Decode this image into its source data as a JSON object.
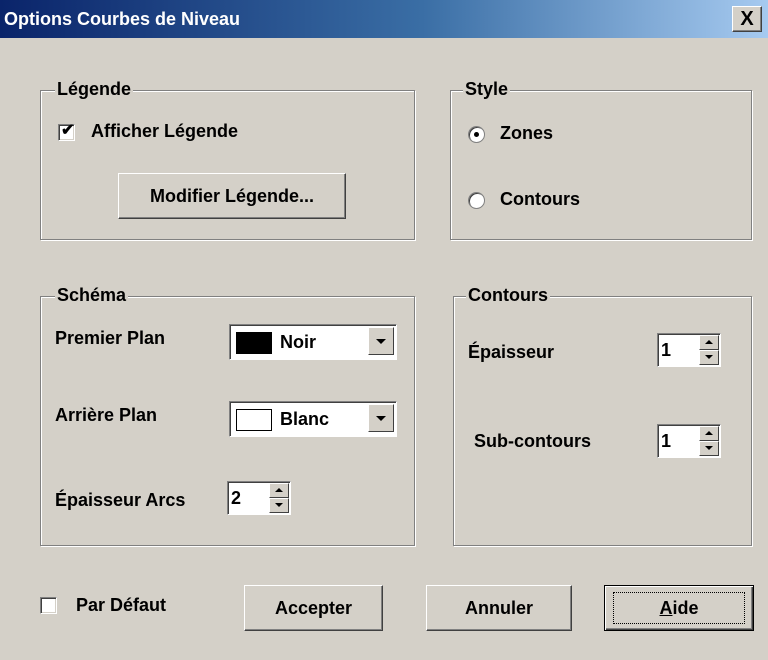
{
  "window": {
    "title": "Options Courbes de Niveau",
    "close_glyph": "X"
  },
  "legende": {
    "group_label": "Légende",
    "show_legend_label": "Afficher Légende",
    "show_legend_checked": true,
    "modify_button": "Modifier Légende..."
  },
  "style": {
    "group_label": "Style",
    "options": [
      {
        "label": "Zones",
        "selected": true
      },
      {
        "label": "Contours",
        "selected": false
      }
    ]
  },
  "schema": {
    "group_label": "Schéma",
    "foreground": {
      "label": "Premier Plan",
      "value": "Noir",
      "swatch_color": "#000000"
    },
    "background": {
      "label": "Arrière Plan",
      "value": "Blanc",
      "swatch_color": "#ffffff"
    },
    "arc_thickness": {
      "label": "Épaisseur Arcs",
      "value": "2"
    }
  },
  "contours": {
    "group_label": "Contours",
    "thickness": {
      "label": "Épaisseur",
      "value": "1"
    },
    "sub_contours": {
      "label": "Sub-contours",
      "value": "1"
    }
  },
  "footer": {
    "default_label": "Par Défaut",
    "default_checked": false,
    "accept_button": "Accepter",
    "cancel_button": "Annuler",
    "help_button_prefix": "A",
    "help_button_rest": "ide"
  }
}
